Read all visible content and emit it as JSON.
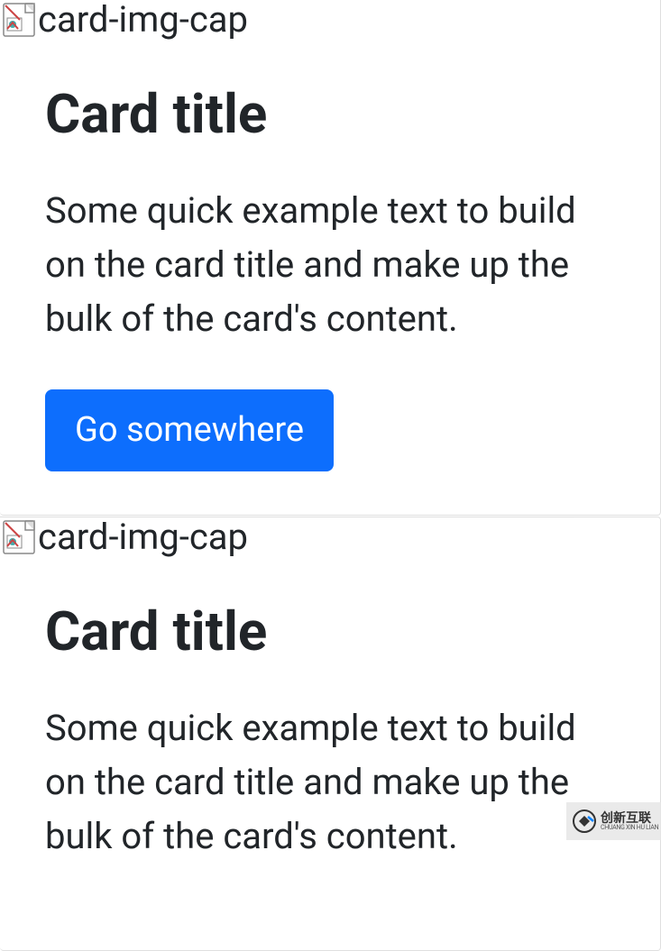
{
  "cards": [
    {
      "img_alt": "card-img-cap",
      "title": "Card title",
      "text": "Some quick example text to build on the card title and make up the bulk of the card's content.",
      "button_label": "Go somewhere"
    },
    {
      "img_alt": "card-img-cap",
      "title": "Card title",
      "text": "Some quick example text to build on the card title and make up the bulk of the card's content."
    }
  ],
  "watermark": {
    "cn": "创新互联",
    "en": "CHUANG XIN HU LIAN"
  }
}
